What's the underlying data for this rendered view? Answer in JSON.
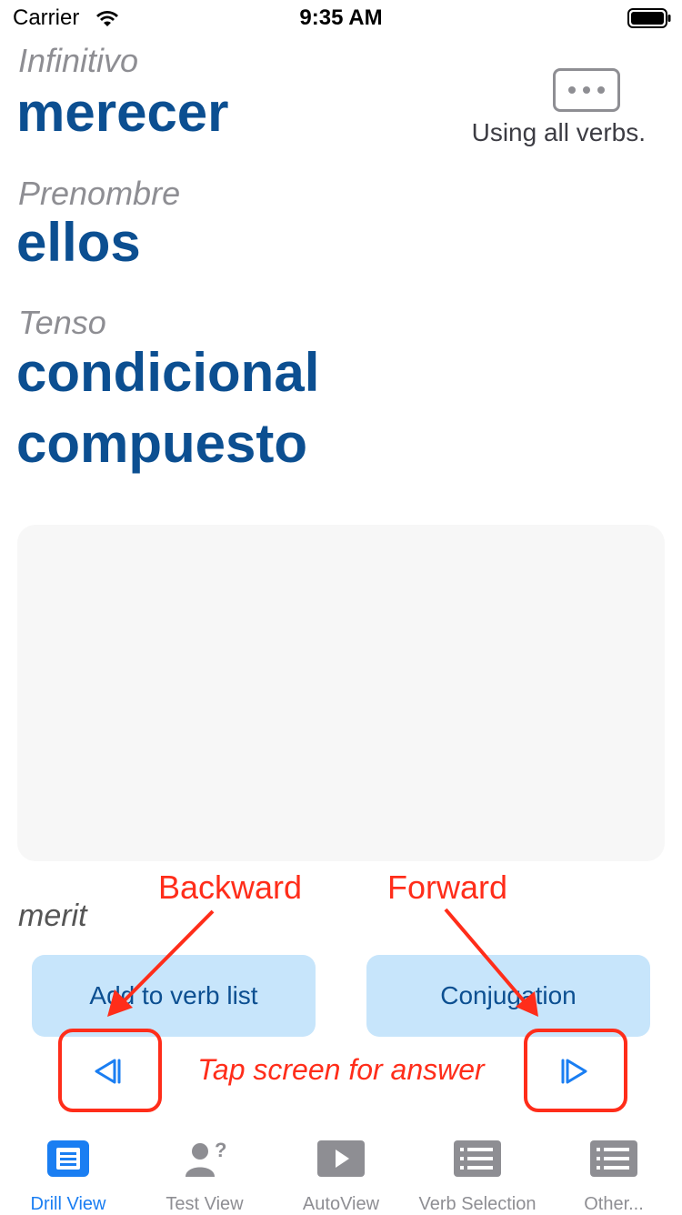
{
  "status_bar": {
    "carrier": "Carrier",
    "time": "9:35 AM"
  },
  "drill": {
    "infinitive_label": "Infinitivo",
    "infinitive_value": "merecer",
    "pronoun_label": "Prenombre",
    "pronoun_value": "ellos",
    "tense_label": "Tenso",
    "tense_value_line1": "condicional",
    "tense_value_line2": "compuesto",
    "translation": "merit",
    "verb_scope": "Using all verbs.",
    "tap_hint": "Tap screen for answer"
  },
  "buttons": {
    "add_to_verb_list": "Add to verb list",
    "conjugation": "Conjugation"
  },
  "annotations": {
    "backward": "Backward",
    "forward": "Forward"
  },
  "tab_bar": {
    "items": [
      {
        "label": "Drill View",
        "icon": "drill-view-icon",
        "selected": true
      },
      {
        "label": "Test View",
        "icon": "test-view-icon",
        "selected": false
      },
      {
        "label": "AutoView",
        "icon": "autoview-icon",
        "selected": false
      },
      {
        "label": "Verb Selection",
        "icon": "verb-selection-icon",
        "selected": false
      },
      {
        "label": "Other...",
        "icon": "other-icon",
        "selected": false
      }
    ]
  },
  "colors": {
    "accent": "#1a7ef2",
    "value_blue": "#0c4f91",
    "annotation_red": "#ff2d1a",
    "tab_inactive": "#8e8e93",
    "button_bg": "#c7e5fb"
  }
}
